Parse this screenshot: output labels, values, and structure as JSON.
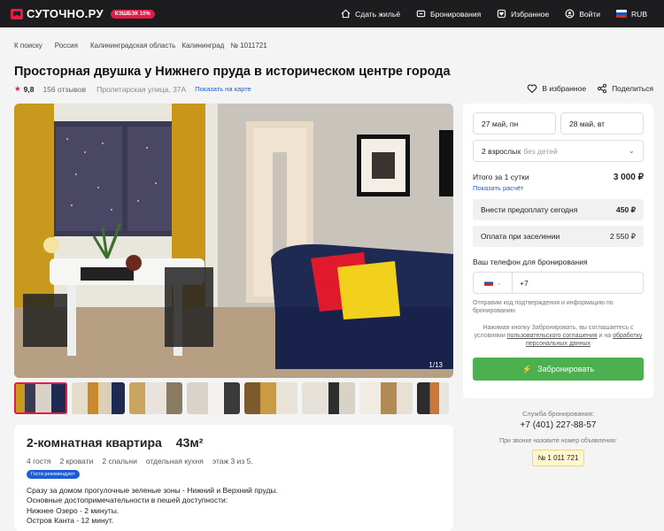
{
  "header": {
    "logo": "СУТОЧНО.РУ",
    "cashback": "КЭШБЭК 10%",
    "nav": [
      {
        "label": "Сдать жильё",
        "icon": "house-icon"
      },
      {
        "label": "Бронирования",
        "icon": "bookings-icon"
      },
      {
        "label": "Избранное",
        "icon": "favorites-icon"
      },
      {
        "label": "Войти",
        "icon": "user-icon"
      },
      {
        "label": "RUB",
        "icon": "flag-ru-icon"
      }
    ]
  },
  "breadcrumbs": [
    "К поиску",
    "Россия",
    "Калининградская область",
    "Калининград",
    "№ 1011721"
  ],
  "listing": {
    "title": "Просторная двушка у Нижнего пруда в историческом центре города",
    "rating": "9,8",
    "reviews": "156 отзывов",
    "address": "Пролетарская улица, 37А",
    "map_link": "Показать на карте",
    "favorite": "В избранное",
    "share": "Поделиться",
    "photo_counter": "1/13"
  },
  "info": {
    "type": "2-комнатная квартира",
    "area": "43м²",
    "specs": [
      "4 гостя",
      "2 кровати",
      "2 спальни",
      "отдельная кухня",
      "этаж 3 из 5."
    ],
    "badge": "Гости рекомендуют",
    "desc": [
      "Сразу за домом прогулочные зеленые зоны - Нижний и Верхний пруды.",
      "Основные достопримечательности в пешей доступности:",
      "Нижнее Озеро - 2 минуты.",
      "Остров Канта - 12 минут."
    ]
  },
  "booking": {
    "checkin": "27 май, пн",
    "checkout": "28 май, вт",
    "guests": "2 взрослых",
    "guests_extra": "без детей",
    "total_label": "Итого за 1 сутки",
    "total_value": "3 000 ₽",
    "calc_link": "Показать расчёт",
    "prepay_label": "Внести предоплату сегодня",
    "prepay_value": "450 ₽",
    "onsite_label": "Оплата при заселении",
    "onsite_value": "2 550 ₽",
    "phone_label": "Ваш телефон для бронирования",
    "phone_code": "+7",
    "sms_note": "Отправим код подтверждения и информацию по бронированию",
    "agree_1": "Нажимая кнопку Забронировать, вы соглашаетесь с условиями ",
    "agree_link1": "пользовательского соглашения",
    "agree_2": " и на ",
    "agree_link2": "обработку персональных данных",
    "button": "Забронировать"
  },
  "support": {
    "label": "Служба бронирования:",
    "phone": "+7 (401) 227-88-57",
    "note": "При звонке назовите номер объявления:",
    "listing_no": "№ 1 011 721"
  },
  "colors": {
    "accent": "#e11d48",
    "link": "#1e5cd6",
    "cta": "#4caf50",
    "header": "#1d1d1f"
  }
}
